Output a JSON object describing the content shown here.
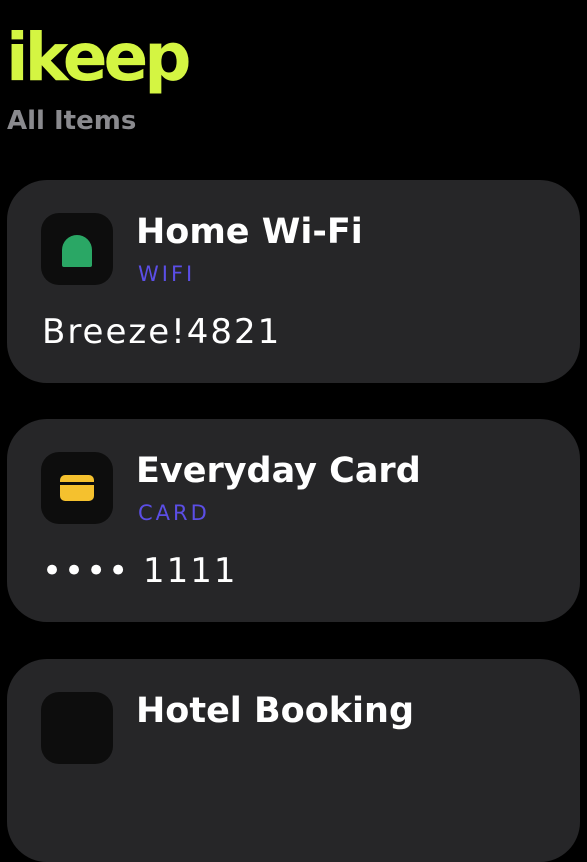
{
  "app": {
    "title": "ikeep",
    "subtitle": "All Items"
  },
  "colors": {
    "accent": "#d4f542",
    "category": "#5b4ee6",
    "card_background": "#262628",
    "wifi_icon": "#2aa765",
    "card_icon": "#f5c12e"
  },
  "items": [
    {
      "title": "Home Wi-Fi",
      "category": "WIFI",
      "value": "Breeze!4821",
      "icon": "wifi-icon"
    },
    {
      "title": "Everyday Card",
      "category": "CARD",
      "value": "•••• 1111",
      "icon": "credit-card-icon"
    },
    {
      "title": "Hotel Booking",
      "icon": "bed-icon"
    }
  ]
}
